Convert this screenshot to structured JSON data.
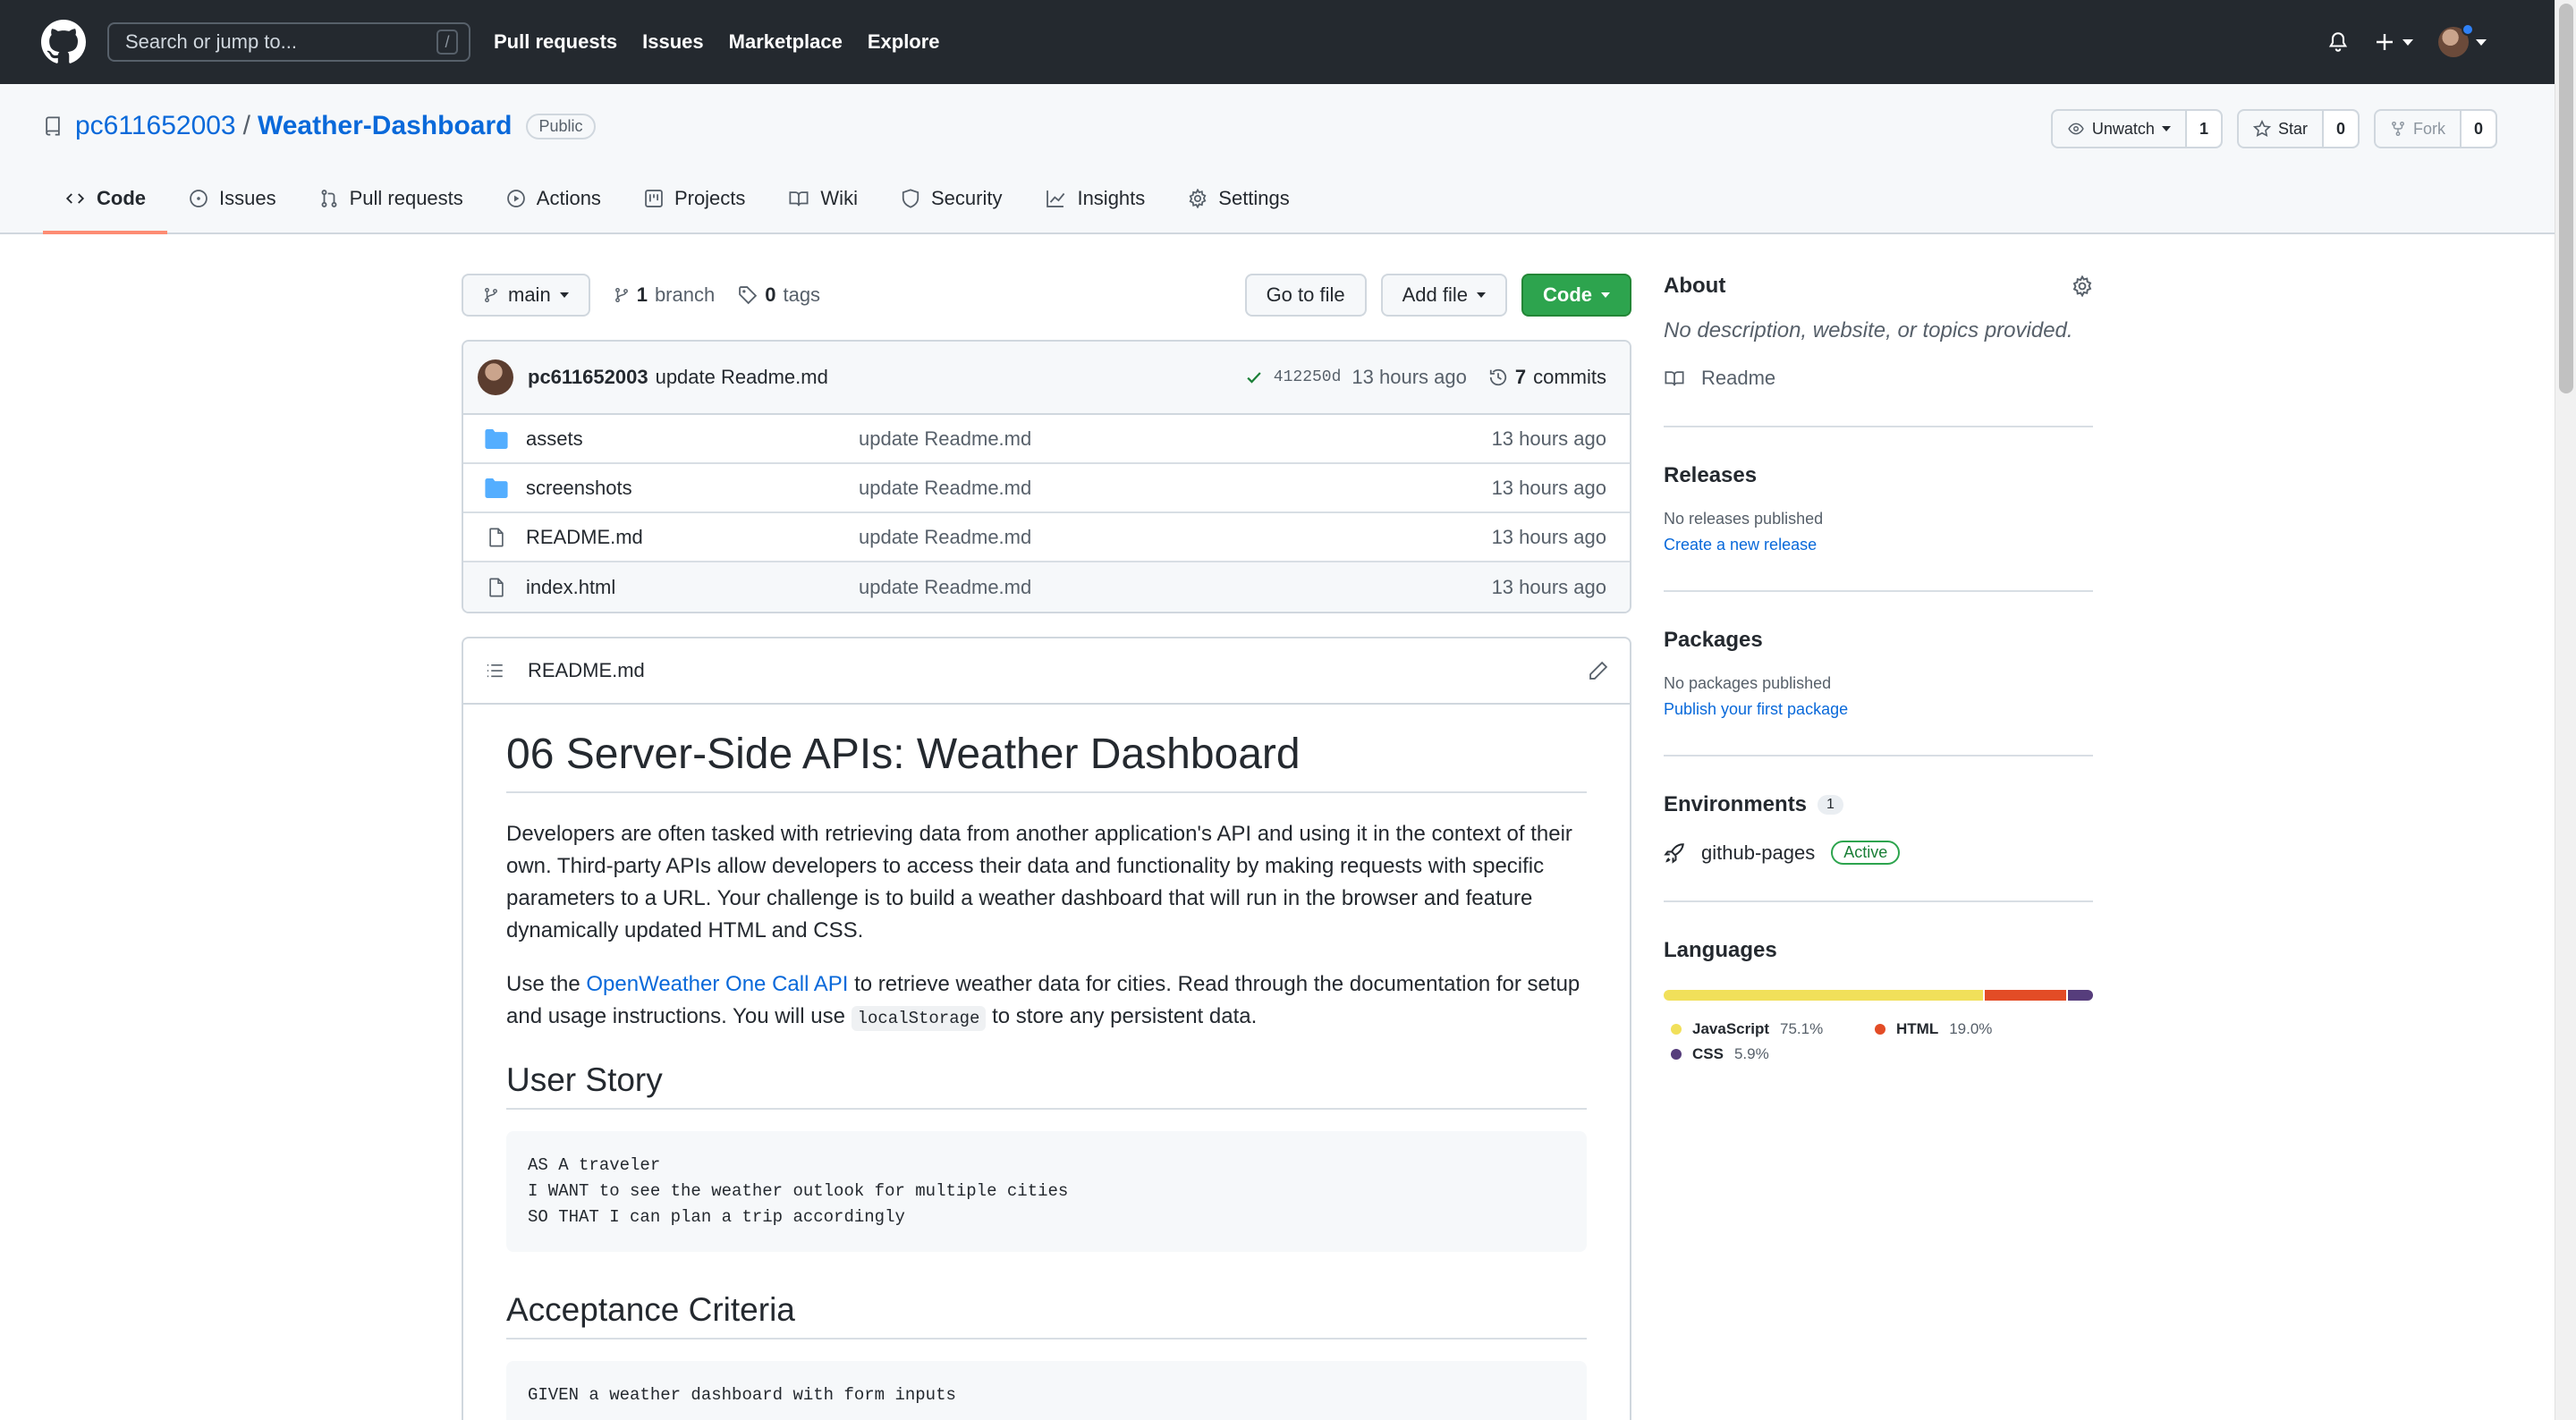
{
  "header": {
    "search_placeholder": "Search or jump to...",
    "search_shortcut": "/",
    "nav": [
      "Pull requests",
      "Issues",
      "Marketplace",
      "Explore"
    ]
  },
  "repo": {
    "owner": "pc611652003",
    "separator": "/",
    "name": "Weather-Dashboard",
    "visibility": "Public",
    "watch_label": "Unwatch",
    "watch_count": "1",
    "star_label": "Star",
    "star_count": "0",
    "fork_label": "Fork",
    "fork_count": "0"
  },
  "tabs": [
    {
      "label": "Code",
      "icon": "code-icon",
      "active": true
    },
    {
      "label": "Issues",
      "icon": "issue-icon"
    },
    {
      "label": "Pull requests",
      "icon": "pull-request-icon"
    },
    {
      "label": "Actions",
      "icon": "play-icon"
    },
    {
      "label": "Projects",
      "icon": "project-icon"
    },
    {
      "label": "Wiki",
      "icon": "book-icon"
    },
    {
      "label": "Security",
      "icon": "shield-icon"
    },
    {
      "label": "Insights",
      "icon": "graph-icon"
    },
    {
      "label": "Settings",
      "icon": "gear-icon"
    }
  ],
  "toolbar": {
    "branch": "main",
    "branch_count": "1",
    "branch_label": "branch",
    "tag_count": "0",
    "tag_label": "tags",
    "go_to_file": "Go to file",
    "add_file": "Add file",
    "code": "Code"
  },
  "latest_commit": {
    "author": "pc611652003",
    "message": "update Readme.md",
    "sha": "412250d",
    "time": "13 hours ago",
    "commit_count": "7",
    "commits_label": "commits"
  },
  "files": [
    {
      "type": "folder",
      "name": "assets",
      "message": "update Readme.md",
      "time": "13 hours ago"
    },
    {
      "type": "folder",
      "name": "screenshots",
      "message": "update Readme.md",
      "time": "13 hours ago"
    },
    {
      "type": "file",
      "name": "README.md",
      "message": "update Readme.md",
      "time": "13 hours ago"
    },
    {
      "type": "file",
      "name": "index.html",
      "message": "update Readme.md",
      "time": "13 hours ago"
    }
  ],
  "readme": {
    "filename": "README.md",
    "title": "06 Server-Side APIs: Weather Dashboard",
    "p1": "Developers are often tasked with retrieving data from another application's API and using it in the context of their own. Third-party APIs allow developers to access their data and functionality by making requests with specific parameters to a URL. Your challenge is to build a weather dashboard that will run in the browser and feature dynamically updated HTML and CSS.",
    "p2_a": "Use the ",
    "p2_link": "OpenWeather One Call API",
    "p2_b": " to retrieve weather data for cities. Read through the documentation for setup and usage instructions. You will use ",
    "p2_code": "localStorage",
    "p2_c": " to store any persistent data.",
    "h_user_story": "User Story",
    "user_story": "AS A traveler\nI WANT to see the weather outlook for multiple cities\nSO THAT I can plan a trip accordingly",
    "h_acceptance": "Acceptance Criteria",
    "acceptance_first": "GIVEN a weather dashboard with form inputs"
  },
  "about": {
    "heading": "About",
    "description": "No description, website, or topics provided.",
    "readme_link": "Readme"
  },
  "releases": {
    "heading": "Releases",
    "empty": "No releases published",
    "link": "Create a new release"
  },
  "packages": {
    "heading": "Packages",
    "empty": "No packages published",
    "link": "Publish your first package"
  },
  "environments": {
    "heading": "Environments",
    "count": "1",
    "name": "github-pages",
    "status": "Active"
  },
  "languages": {
    "heading": "Languages",
    "items": [
      {
        "name": "JavaScript",
        "percent": "75.1%",
        "value": 75.1,
        "color": "#f1e05a"
      },
      {
        "name": "HTML",
        "percent": "19.0%",
        "value": 19.0,
        "color": "#e34c26"
      },
      {
        "name": "CSS",
        "percent": "5.9%",
        "value": 5.9,
        "color": "#563d7c"
      }
    ]
  }
}
